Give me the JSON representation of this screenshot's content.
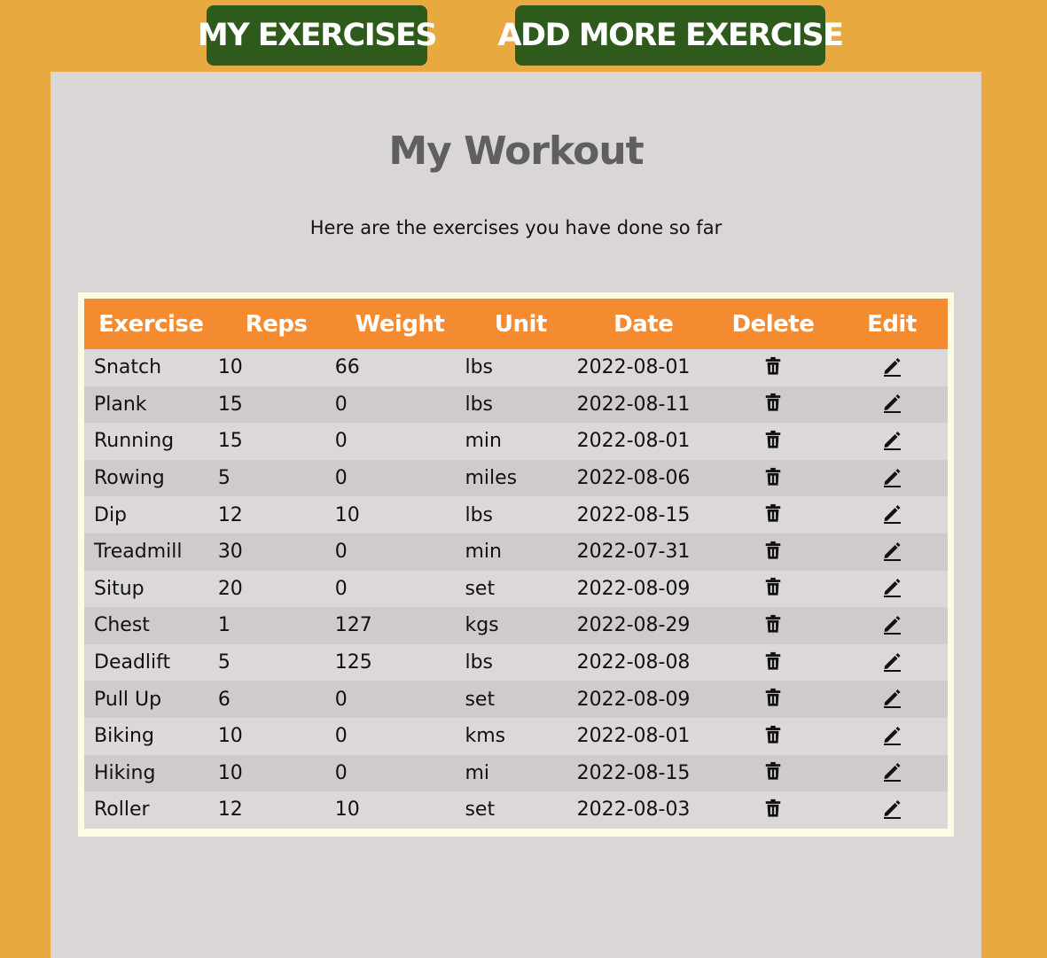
{
  "nav": {
    "my_exercises_label": "MY EXERCISES",
    "add_exercise_label": "ADD MORE EXERCISE"
  },
  "page": {
    "title": "My Workout",
    "subtitle": "Here are the exercises you have done so far"
  },
  "table": {
    "headers": {
      "exercise": "Exercise",
      "reps": "Reps",
      "weight": "Weight",
      "unit": "Unit",
      "date": "Date",
      "delete": "Delete",
      "edit": "Edit"
    },
    "rows": [
      {
        "exercise": "Snatch",
        "reps": "10",
        "weight": "66",
        "unit": "lbs",
        "date": "2022-08-01"
      },
      {
        "exercise": "Plank",
        "reps": "15",
        "weight": "0",
        "unit": "lbs",
        "date": "2022-08-11"
      },
      {
        "exercise": "Running",
        "reps": "15",
        "weight": "0",
        "unit": "min",
        "date": "2022-08-01"
      },
      {
        "exercise": "Rowing",
        "reps": "5",
        "weight": "0",
        "unit": "miles",
        "date": "2022-08-06"
      },
      {
        "exercise": "Dip",
        "reps": "12",
        "weight": "10",
        "unit": "lbs",
        "date": "2022-08-15"
      },
      {
        "exercise": "Treadmill",
        "reps": "30",
        "weight": "0",
        "unit": "min",
        "date": "2022-07-31"
      },
      {
        "exercise": "Situp",
        "reps": "20",
        "weight": "0",
        "unit": "set",
        "date": "2022-08-09"
      },
      {
        "exercise": "Chest",
        "reps": "1",
        "weight": "127",
        "unit": "kgs",
        "date": "2022-08-29"
      },
      {
        "exercise": "Deadlift",
        "reps": "5",
        "weight": "125",
        "unit": "lbs",
        "date": "2022-08-08"
      },
      {
        "exercise": "Pull Up",
        "reps": "6",
        "weight": "0",
        "unit": "set",
        "date": "2022-08-09"
      },
      {
        "exercise": "Biking",
        "reps": "10",
        "weight": "0",
        "unit": "kms",
        "date": "2022-08-01"
      },
      {
        "exercise": "Hiking",
        "reps": "10",
        "weight": "0",
        "unit": "mi",
        "date": "2022-08-15"
      },
      {
        "exercise": "Roller",
        "reps": "12",
        "weight": "10",
        "unit": "set",
        "date": "2022-08-03"
      }
    ],
    "delete_icon": "trash-icon",
    "edit_icon": "pencil-icon"
  },
  "colors": {
    "background": "#e8a941",
    "nav_button": "#2e5a1c",
    "panel": "#dad6d6",
    "table_header": "#f58b30",
    "table_frame": "#fdfbe3"
  }
}
